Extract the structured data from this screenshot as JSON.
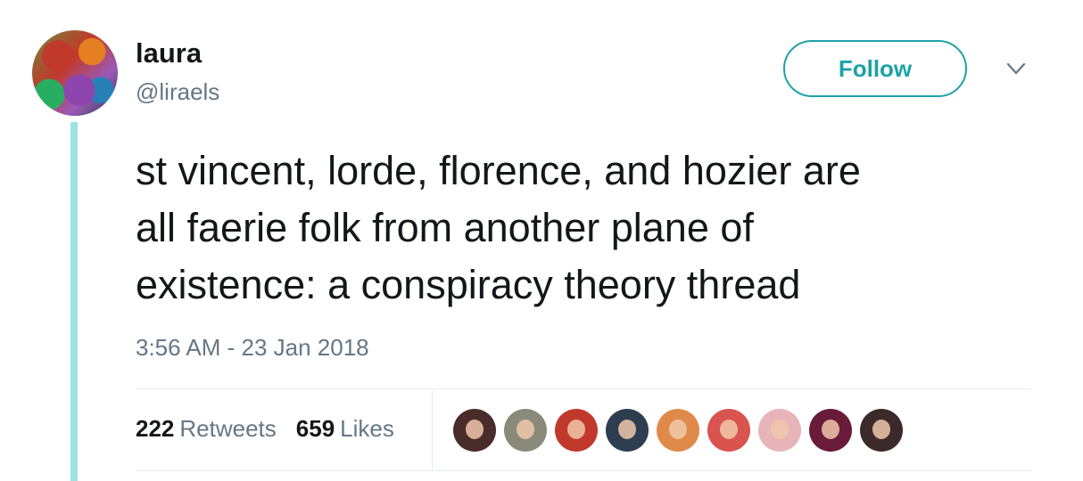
{
  "user": {
    "name": "laura",
    "handle": "@liraels"
  },
  "actions": {
    "follow_label": "Follow",
    "more_icon": "chevron-down-icon"
  },
  "tweet": {
    "lines": [
      "st vincent, lorde, florence, and hozier are",
      "all faerie folk from another plane of",
      "existence: a conspiracy theory thread"
    ],
    "timestamp": "3:56 AM - 23 Jan 2018"
  },
  "stats": {
    "retweets_count": "222",
    "retweets_label": "Retweets",
    "likes_count": "659",
    "likes_label": "Likes"
  },
  "colors": {
    "accent": "#1da1a8",
    "thread_line": "#9ee1e6",
    "secondary_text": "#657786",
    "liker_backgrounds": [
      "#4a2c2a",
      "#8a8a7a",
      "#c0392b",
      "#2c3e50",
      "#e08a4a",
      "#d9534f",
      "#e8b4b8",
      "#6a1b3a",
      "#3b2a2a"
    ]
  }
}
